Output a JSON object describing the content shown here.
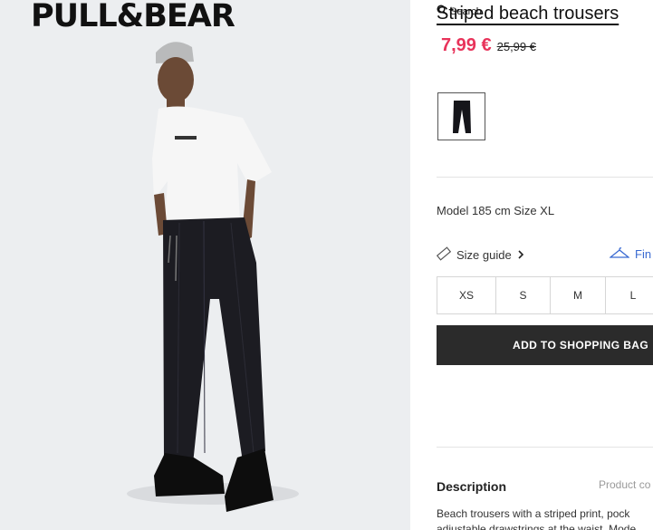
{
  "brand": {
    "logo_text": "PULL&BEAR"
  },
  "header": {
    "search_label": "Search"
  },
  "product": {
    "title": "Striped beach trousers",
    "price": "7,99 €",
    "old_price": "25,99 €",
    "model_info": "Model 185 cm Size XL",
    "size_guide_label": "Size guide",
    "find_size_label": "Fin",
    "sizes": [
      "XS",
      "S",
      "M",
      "L"
    ],
    "add_to_bag_label": "ADD TO SHOPPING BAG",
    "description_heading": "Description",
    "product_code_label": "Product co",
    "description_text": "Beach trousers with a striped print, pock adjustable drawstrings at the waist. Mode"
  },
  "colors": {
    "sale_price": "#e8335a",
    "button_bg": "#2b2b2b",
    "link_blue": "#3a6ad2",
    "photo_bg": "#eceef0"
  },
  "icons": {
    "search": "search-icon",
    "ruler": "ruler-icon",
    "hanger": "hanger-icon",
    "chevron": "chevron-right-icon"
  }
}
